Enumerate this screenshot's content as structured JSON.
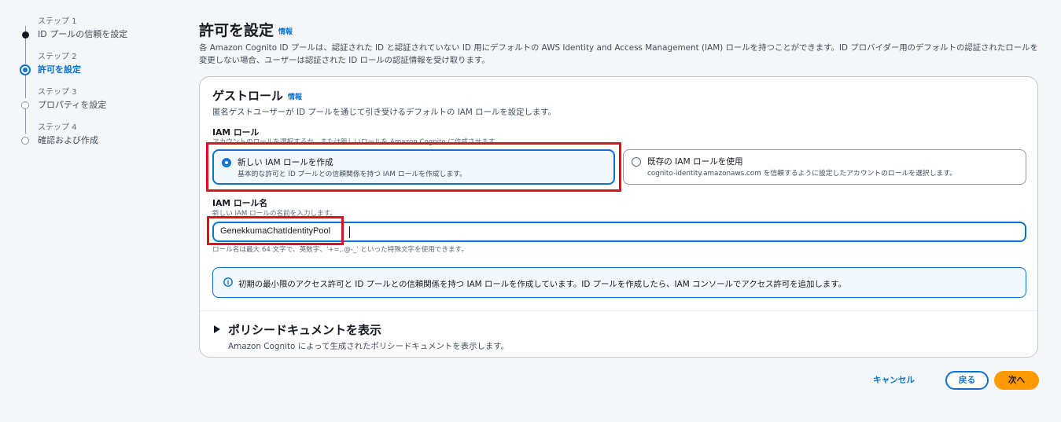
{
  "steps": [
    {
      "caption": "ステップ 1",
      "title": "ID プールの信頼を設定",
      "state": "completed"
    },
    {
      "caption": "ステップ 2",
      "title": "許可を設定",
      "state": "current"
    },
    {
      "caption": "ステップ 3",
      "title": "プロパティを設定",
      "state": "pending"
    },
    {
      "caption": "ステップ 4",
      "title": "確認および作成",
      "state": "pending"
    }
  ],
  "header": {
    "title": "許可を設定",
    "info": "情報",
    "description": "各 Amazon Cognito ID プールは、認証された ID と認証されていない ID 用にデフォルトの AWS Identity and Access Management (IAM) ロールを持つことができます。ID プロバイダー用のデフォルトの認証されたロールを変更しない場合、ユーザーは認証された ID ロールの認証情報を受け取ります。"
  },
  "guest_role": {
    "title": "ゲストロール",
    "info": "情報",
    "description": "匿名ゲストユーザーが ID プールを通じて引き受けるデフォルトの IAM ロールを設定します。",
    "iam_role_label": "IAM ロール",
    "iam_role_description": "アカウントのロールを選択するか、または新しいロールを Amazon Cognito に作成させます。",
    "options": [
      {
        "title": "新しい IAM ロールを作成",
        "description": "基本的な許可と ID プールとの信頼関係を持つ IAM ロールを作成します。",
        "selected": true
      },
      {
        "title": "既存の IAM ロールを使用",
        "description": "cognito-identity.amazonaws.com を信頼するように設定したアカウントのロールを選択します。",
        "selected": false
      }
    ],
    "role_name_label": "IAM ロール名",
    "role_name_description": "新しい IAM ロールの名前を入力します。",
    "role_name_value": "GenekkumaChatIdentityPool",
    "role_name_constraint": "ロール名は最大 64 文字で、英数字、'+=,.@-_' といった特殊文字を使用できます。",
    "alert_text": "初期の最小限のアクセス許可と ID プールとの信頼関係を持つ IAM ロールを作成しています。ID プールを作成したら、IAM コンソールでアクセス許可を追加します。"
  },
  "policy_expander": {
    "title": "ポリシードキュメントを表示",
    "description": "Amazon Cognito によって生成されたポリシードキュメントを表示します。",
    "expanded": false
  },
  "actions": {
    "cancel": "キャンセル",
    "back": "戻る",
    "next": "次へ"
  },
  "colors": {
    "accent": "#0972d3",
    "primary_button": "#ff9900",
    "highlight": "#e01020"
  },
  "icons": [
    "info-icon",
    "caret-right-icon"
  ]
}
